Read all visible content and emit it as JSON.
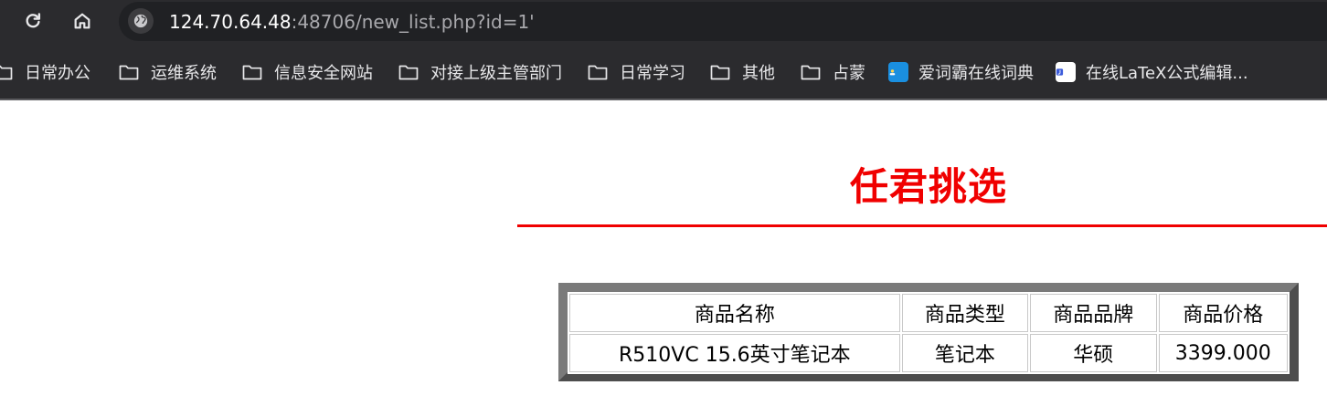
{
  "browser": {
    "url_host": "124.70.64.48",
    "url_rest": ":48706/new_list.php?id=1'",
    "bookmarks": [
      {
        "label": "日常办公",
        "icon": "folder-icon"
      },
      {
        "label": "运维系统",
        "icon": "folder-icon"
      },
      {
        "label": "信息安全网站",
        "icon": "folder-icon"
      },
      {
        "label": "对接上级主管部门",
        "icon": "folder-icon"
      },
      {
        "label": "日常学习",
        "icon": "folder-icon"
      },
      {
        "label": "其他",
        "icon": "folder-icon"
      },
      {
        "label": "占蒙",
        "icon": "folder-icon"
      },
      {
        "label": "爱词霸在线词典",
        "icon": "iciba-favicon"
      },
      {
        "label": "在线LaTeX公式编辑...",
        "icon": "latex-favicon"
      }
    ]
  },
  "page": {
    "title": "任君挑选",
    "table": {
      "headers": [
        "商品名称",
        "商品类型",
        "商品品牌",
        "商品价格"
      ],
      "rows": [
        [
          "R510VC 15.6英寸笔记本",
          "笔记本",
          "华硕",
          "3399.000"
        ]
      ]
    }
  },
  "colors": {
    "chrome_bg": "#2b2b2e",
    "title_red": "#f00000",
    "table_border": "#4d4d4d"
  }
}
